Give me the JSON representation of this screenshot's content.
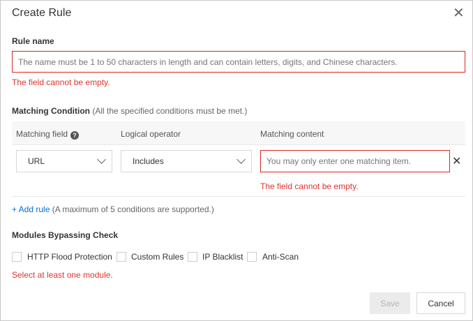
{
  "dialog": {
    "title": "Create Rule"
  },
  "rule_name": {
    "label": "Rule name",
    "placeholder": "The name must be 1 to 50 characters in length and can contain letters, digits, and Chinese characters.",
    "value": "",
    "error": "The field cannot be empty."
  },
  "matching": {
    "label": "Matching Condition",
    "hint": "(All the specified conditions must be met.)",
    "columns": [
      "Matching field",
      "Logical operator",
      "Matching content"
    ],
    "row": {
      "field": "URL",
      "operator": "Includes",
      "content_placeholder": "You may only enter one matching item.",
      "content_error": "The field cannot be empty."
    },
    "add_rule": "+ Add rule",
    "add_rule_hint": "(A maximum of 5 conditions are supported.)"
  },
  "modules": {
    "label": "Modules Bypassing Check",
    "options": [
      {
        "label": "HTTP Flood Protection",
        "checked": false
      },
      {
        "label": "Custom Rules",
        "checked": false
      },
      {
        "label": "IP Blacklist",
        "checked": false
      },
      {
        "label": "Anti-Scan",
        "checked": false
      }
    ],
    "error": "Select at least one module."
  },
  "footer": {
    "save": "Save",
    "cancel": "Cancel"
  }
}
